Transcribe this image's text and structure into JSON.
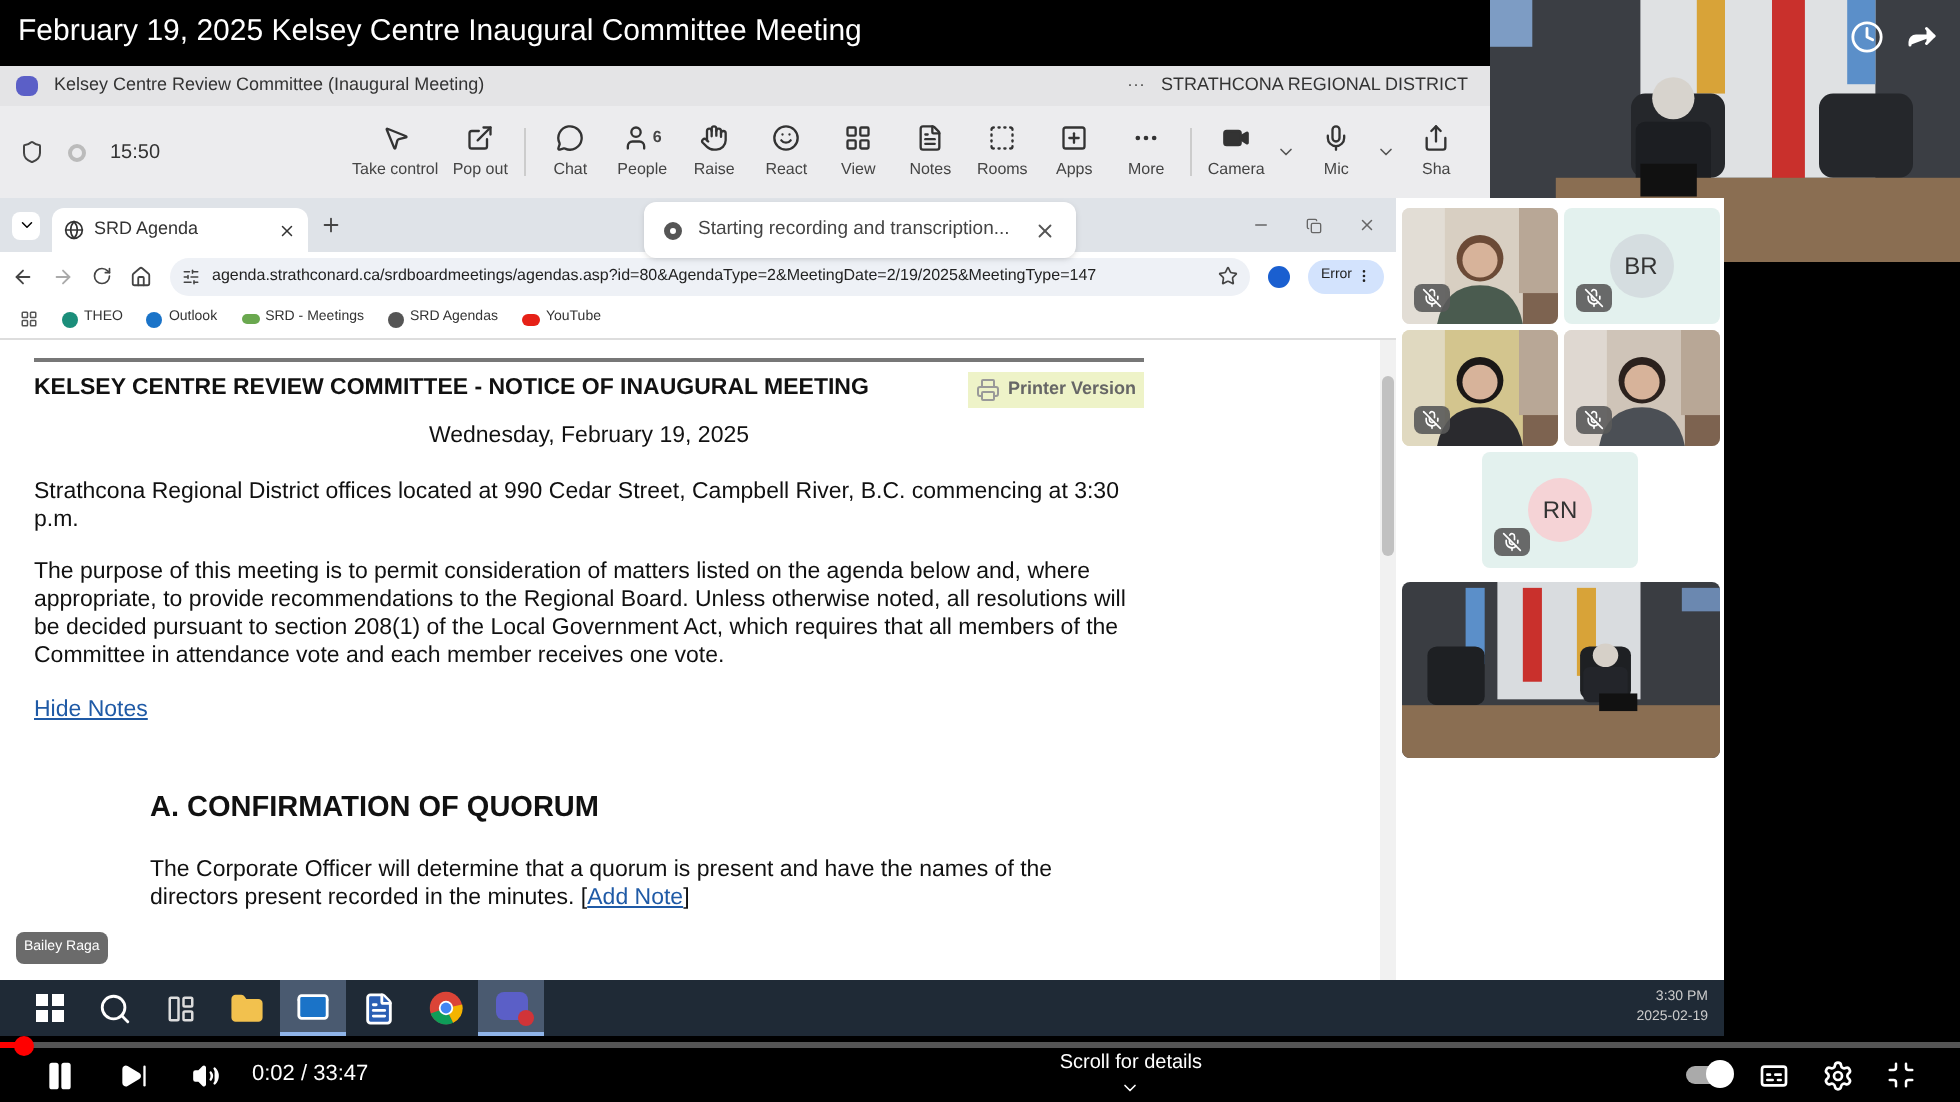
{
  "video_title": "February 19, 2025 Kelsey Centre Inaugural Committee Meeting",
  "teams": {
    "meeting_title": "Kelsey Centre Review Committee (Inaugural Meeting)",
    "more": "···",
    "organization": "STRATHCONA REGIONAL DISTRICT",
    "timer": "15:50",
    "toolbar": [
      {
        "label": "Take control"
      },
      {
        "label": "Pop out"
      },
      {
        "label": "Chat"
      },
      {
        "label": "People",
        "count": "6"
      },
      {
        "label": "Raise"
      },
      {
        "label": "React"
      },
      {
        "label": "View"
      },
      {
        "label": "Notes"
      },
      {
        "label": "Rooms"
      },
      {
        "label": "Apps"
      },
      {
        "label": "More"
      },
      {
        "label": "Camera",
        "dropdown": true
      },
      {
        "label": "Mic",
        "dropdown": true
      },
      {
        "label": "Sha"
      }
    ]
  },
  "toast": {
    "text": "Starting recording and transcription..."
  },
  "browser": {
    "tab": "SRD Agenda",
    "url": "agenda.strathconard.ca/srdboardmeetings/agendas.asp?id=80&AgendaType=2&MeetingDate=2/19/2025&MeetingType=147",
    "profile": "Error",
    "bookmarks": [
      "THEO",
      "Outlook",
      "SRD - Meetings",
      "SRD Agendas",
      "YouTube"
    ]
  },
  "page": {
    "heading": "KELSEY CENTRE REVIEW COMMITTEE - NOTICE OF INAUGURAL MEETING",
    "printer": "Printer Version",
    "date": "Wednesday, February 19, 2025",
    "paragraphs": [
      "Strathcona Regional District offices located at 990 Cedar Street, Campbell River, B.C. commencing at 3:30 p.m.",
      "The purpose of this meeting is to permit consideration of matters listed on the agenda below and, where appropriate, to provide recommendations to the Regional Board. Unless otherwise noted, all resolutions will be decided pursuant to section 208(1) of the Local Government Act, which requires that all members of the Committee in attendance vote and each member receives one vote."
    ],
    "hide_notes": "Hide Notes",
    "section": "A. CONFIRMATION OF QUORUM",
    "section_text": "The Corporate Officer will determine that a quorum is present and have the names of the directors present recorded in the minutes.",
    "open_bracket": "[",
    "add_note": "Add Note",
    "close_bracket": "]"
  },
  "participants": [
    {
      "kind": "video",
      "muted": true
    },
    {
      "kind": "initials",
      "initials": "BR",
      "color": "#d5dde0",
      "muted": true
    },
    {
      "kind": "video",
      "muted": true
    },
    {
      "kind": "video",
      "muted": true
    },
    {
      "kind": "initials",
      "initials": "RN",
      "color": "#f5d3d6",
      "muted": true
    },
    {
      "kind": "room"
    }
  ],
  "presenter": "Bailey Raga",
  "taskbar": {
    "apps": [
      {
        "selected": false
      },
      {
        "selected": false
      },
      {
        "selected": false
      },
      {
        "selected": false
      },
      {
        "selected": true
      },
      {
        "selected": false
      },
      {
        "selected": false
      },
      {
        "selected": true
      }
    ],
    "time": "3:30 PM",
    "date": "2025-02-19"
  },
  "player": {
    "level": 0.012,
    "time": "0:02 / 33:47",
    "details": "Scroll for details",
    "autoplay": true
  }
}
